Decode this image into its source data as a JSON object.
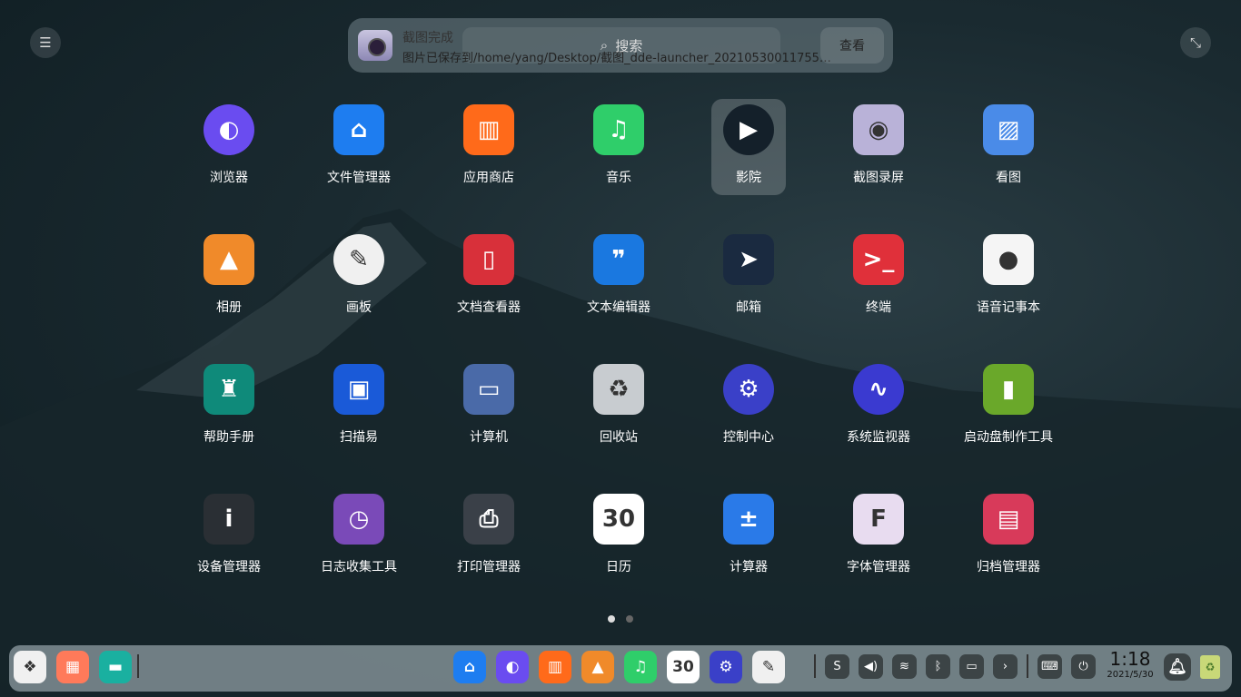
{
  "notification": {
    "title": "截图完成",
    "body": "图片已保存到/home/yang/Desktop/截图_dde-launcher_20210530011755…",
    "view_button": "查看"
  },
  "search": {
    "placeholder": "搜索",
    "icon": "search-icon"
  },
  "apps": [
    {
      "label": "浏览器",
      "color": "#6a4cf0",
      "glyph": "◐"
    },
    {
      "label": "文件管理器",
      "color": "#1e7df0",
      "glyph": "⌂"
    },
    {
      "label": "应用商店",
      "color": "#ff6a1a",
      "glyph": "▥"
    },
    {
      "label": "音乐",
      "color": "#2fce6a",
      "glyph": "♫"
    },
    {
      "label": "影院",
      "color": "#14202a",
      "glyph": "▶"
    },
    {
      "label": "截图录屏",
      "color": "#b9b2d8",
      "glyph": "◉"
    },
    {
      "label": "看图",
      "color": "#4a8be8",
      "glyph": "▨"
    },
    {
      "label": "相册",
      "color": "#f08a2a",
      "glyph": "▲"
    },
    {
      "label": "画板",
      "color": "#f0f0f0",
      "glyph": "✎"
    },
    {
      "label": "文档查看器",
      "color": "#d8303a",
      "glyph": "▯"
    },
    {
      "label": "文本编辑器",
      "color": "#1a78e0",
      "glyph": "❞"
    },
    {
      "label": "邮箱",
      "color": "#1a2a40",
      "glyph": "➤"
    },
    {
      "label": "终端",
      "color": "#e0303a",
      "glyph": ">_"
    },
    {
      "label": "语音记事本",
      "color": "#f5f5f5",
      "glyph": "●"
    },
    {
      "label": "帮助手册",
      "color": "#0f8a7a",
      "glyph": "♜"
    },
    {
      "label": "扫描易",
      "color": "#1a5ad8",
      "glyph": "▣"
    },
    {
      "label": "计算机",
      "color": "#4a6aa8",
      "glyph": "▭"
    },
    {
      "label": "回收站",
      "color": "#c8ccd0",
      "glyph": "♻"
    },
    {
      "label": "控制中心",
      "color": "#3a40c8",
      "glyph": "⚙"
    },
    {
      "label": "系统监视器",
      "color": "#3a3ad0",
      "glyph": "∿"
    },
    {
      "label": "启动盘制作工具",
      "color": "#6aa82a",
      "glyph": "▮"
    },
    {
      "label": "设备管理器",
      "color": "#2a2f34",
      "glyph": "i"
    },
    {
      "label": "日志收集工具",
      "color": "#7a4ab8",
      "glyph": "◷"
    },
    {
      "label": "打印管理器",
      "color": "#3a4048",
      "glyph": "⎙"
    },
    {
      "label": "日历",
      "color": "#ffffff",
      "glyph": "30"
    },
    {
      "label": "计算器",
      "color": "#2a7ae8",
      "glyph": "±"
    },
    {
      "label": "字体管理器",
      "color": "#e8dcf0",
      "glyph": "F"
    },
    {
      "label": "归档管理器",
      "color": "#d83a5a",
      "glyph": "▤"
    }
  ],
  "selected_app": "影院",
  "pages": {
    "current": 1,
    "total": 2
  },
  "dock": {
    "left": [
      {
        "name": "launcher",
        "color": "#f0f0f0",
        "glyph": "❖"
      },
      {
        "name": "multitask-view",
        "color": "#ff7a5a",
        "glyph": "▦"
      },
      {
        "name": "show-desktop",
        "color": "#1ab0a0",
        "glyph": "▬"
      }
    ],
    "apps": [
      {
        "name": "file-manager",
        "color": "#1e7df0",
        "glyph": "⌂"
      },
      {
        "name": "browser",
        "color": "#6a4cf0",
        "glyph": "◐"
      },
      {
        "name": "app-store",
        "color": "#ff6a1a",
        "glyph": "▥"
      },
      {
        "name": "album",
        "color": "#f08a2a",
        "glyph": "▲"
      },
      {
        "name": "music",
        "color": "#2fce6a",
        "glyph": "♫"
      },
      {
        "name": "calendar",
        "color": "#ffffff",
        "glyph": "30"
      },
      {
        "name": "control-center",
        "color": "#3a40c8",
        "glyph": "⚙"
      },
      {
        "name": "draw",
        "color": "#f0f0f0",
        "glyph": "✎"
      }
    ],
    "tray": [
      {
        "name": "input-method",
        "glyph": "S"
      },
      {
        "name": "volume",
        "glyph": "◀)"
      },
      {
        "name": "wifi",
        "glyph": "≋"
      },
      {
        "name": "bluetooth",
        "glyph": "ᛒ"
      },
      {
        "name": "battery",
        "glyph": "▭"
      },
      {
        "name": "expand",
        "glyph": "›"
      },
      {
        "name": "keyboard",
        "glyph": "⌨"
      },
      {
        "name": "power",
        "glyph": "⏻"
      }
    ],
    "time": "1:18",
    "date": "2021/5/30"
  }
}
